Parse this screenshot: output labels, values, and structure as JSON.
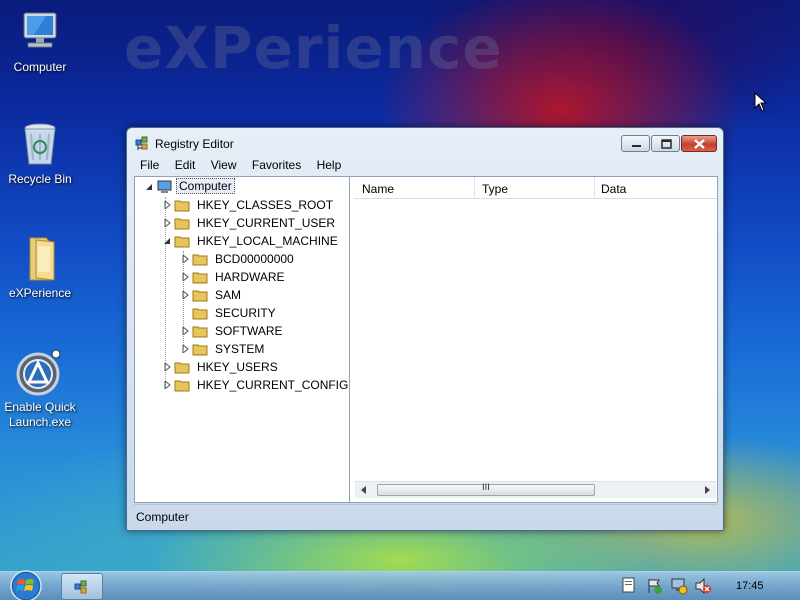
{
  "desktop": {
    "watermark": "eXPerience",
    "icons": [
      {
        "label": "Computer"
      },
      {
        "label": "Recycle Bin"
      },
      {
        "label": "eXPerience"
      },
      {
        "label_line1": "Enable Quick",
        "label_line2": "Launch.exe"
      }
    ]
  },
  "window": {
    "title": "Registry Editor",
    "menu": [
      "File",
      "Edit",
      "View",
      "Favorites",
      "Help"
    ],
    "tree": {
      "root": "Computer",
      "hives": [
        "HKEY_CLASSES_ROOT",
        "HKEY_CURRENT_USER",
        "HKEY_LOCAL_MACHINE",
        "HKEY_USERS",
        "HKEY_CURRENT_CONFIG"
      ],
      "hklm_children": [
        "BCD00000000",
        "HARDWARE",
        "SAM",
        "SECURITY",
        "SOFTWARE",
        "SYSTEM"
      ]
    },
    "columns": [
      "Name",
      "Type",
      "Data"
    ],
    "scroll_grip": "III",
    "status": "Computer"
  },
  "taskbar": {
    "clock": "17:45"
  },
  "colors": {
    "folder": "#e8c45a",
    "window_frame": "#c9d9ea",
    "close_button": "#c2402e"
  }
}
